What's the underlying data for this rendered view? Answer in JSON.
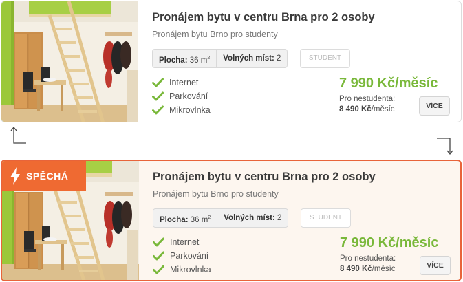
{
  "listings": [
    {
      "variant": "normal",
      "title": "Pronájem bytu v centru Brna pro 2 osoby",
      "subtitle": "Pronájem bytu Brno pro studenty",
      "area_label": "Plocha:",
      "area_value": "36 m",
      "area_unit_exp": "2",
      "free_label": "Volných míst:",
      "free_value": "2",
      "tag": "STUDENT",
      "features": [
        "Internet",
        "Parkování",
        "Mikrovlnka"
      ],
      "price": "7 990 Kč/měsíc",
      "nonstudent_label": "Pro nestudenta:",
      "nonstudent_price": "8 490 Kč",
      "nonstudent_unit": "/měsíc",
      "more_button": "VÍCE"
    },
    {
      "variant": "urgent",
      "badge": "SPĚCHÁ",
      "title": "Pronájem bytu v centru Brna pro 2 osoby",
      "subtitle": "Pronájem bytu Brno pro studenty",
      "area_label": "Plocha:",
      "area_value": "36 m",
      "area_unit_exp": "2",
      "free_label": "Volných míst:",
      "free_value": "2",
      "tag": "STUDENT",
      "features": [
        "Internet",
        "Parkování",
        "Mikrovlnka"
      ],
      "price": "7 990 Kč/měsíc",
      "nonstudent_label": "Pro nestudenta:",
      "nonstudent_price": "8 490 Kč",
      "nonstudent_unit": "/měsíc",
      "more_button": "VÍCE"
    }
  ],
  "colors": {
    "price_green": "#79b83a",
    "urgent_orange": "#ef6a32",
    "urgent_background": "#fdf6ef"
  }
}
